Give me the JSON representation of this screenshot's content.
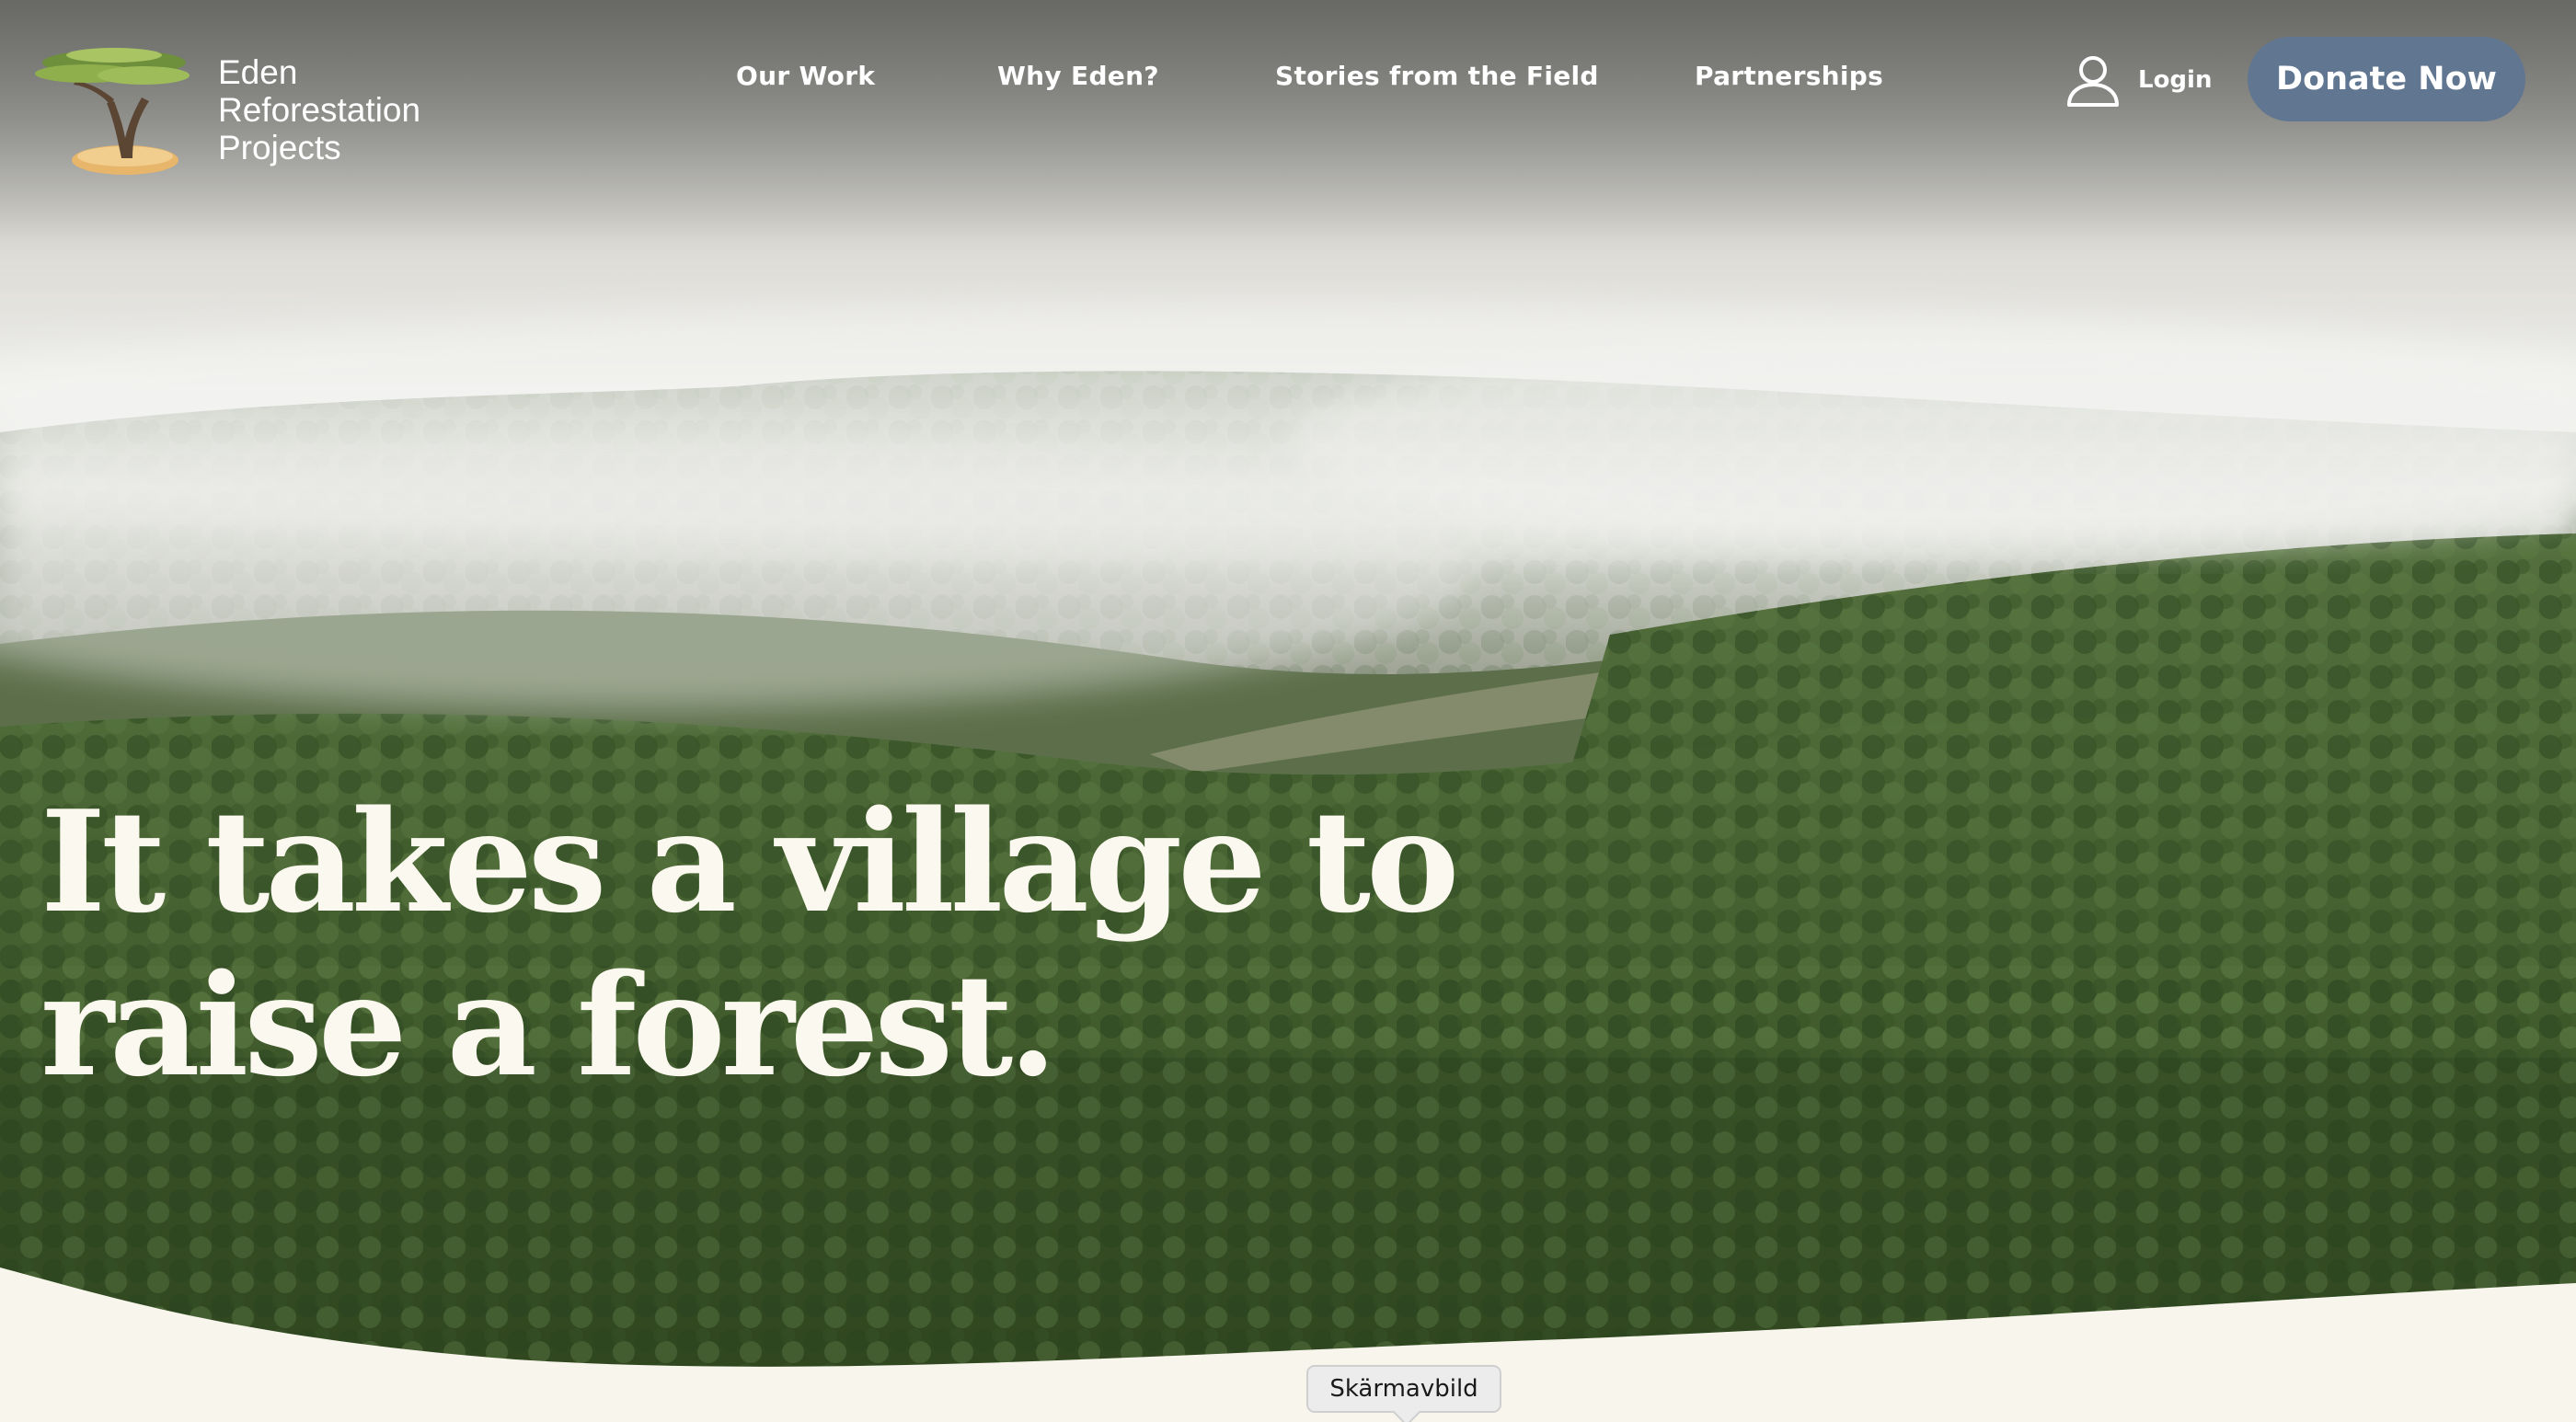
{
  "brand": {
    "line1": "Eden",
    "line2": "Reforestation",
    "line3": "Projects",
    "logo_icon": "acacia-tree-logo"
  },
  "nav": {
    "items": [
      {
        "label": "Our Work"
      },
      {
        "label": "Why Eden?"
      },
      {
        "label": "Stories from the Field"
      },
      {
        "label": "Partnerships"
      }
    ],
    "login_label": "Login",
    "login_icon": "user-icon",
    "donate_label": "Donate Now"
  },
  "hero": {
    "headline_line1": "It takes a village to",
    "headline_line2": "raise a forest."
  },
  "tooltip": {
    "label": "Skärmavbild"
  },
  "colors": {
    "donate_button": "#617691",
    "cream": "#f8f6ec",
    "forest": "#3f5a2c"
  }
}
